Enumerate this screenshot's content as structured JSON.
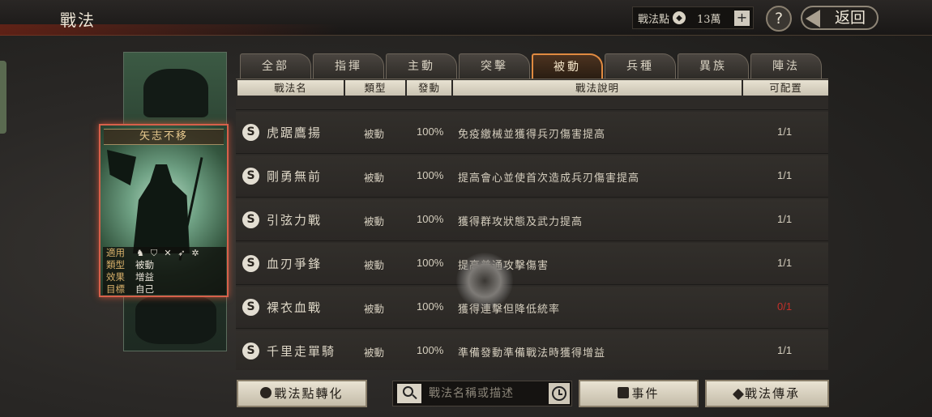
{
  "header": {
    "title": "戰法",
    "points_label": "戰法點",
    "points_value": "13萬",
    "add_label": "+",
    "help_label": "?",
    "back_label": "返回"
  },
  "card": {
    "title": "矢志不移",
    "rows": [
      {
        "key": "適用",
        "value": ""
      },
      {
        "key": "類型",
        "value": "被動"
      },
      {
        "key": "效果",
        "value": "增益"
      },
      {
        "key": "目標",
        "value": "自己"
      }
    ],
    "applicable_icons": [
      "cavalry-icon",
      "shield-icon",
      "bow-icon",
      "spear-icon",
      "siege-icon"
    ]
  },
  "tabs": [
    {
      "label": "全部",
      "active": false
    },
    {
      "label": "指揮",
      "active": false
    },
    {
      "label": "主動",
      "active": false
    },
    {
      "label": "突擊",
      "active": false
    },
    {
      "label": "被動",
      "active": true
    },
    {
      "label": "兵種",
      "active": false
    },
    {
      "label": "異族",
      "active": false
    },
    {
      "label": "陣法",
      "active": false
    }
  ],
  "table": {
    "headers": {
      "name": "戰法名",
      "type": "類型",
      "rate": "發動",
      "desc": "戰法說明",
      "conf": "可配置"
    },
    "rows": [
      {
        "grade": "S",
        "name": "虎踞鷹揚",
        "type": "被動",
        "rate": "100%",
        "desc": "免疫繳械並獲得兵刃傷害提高",
        "conf": "1/1",
        "conf_red": false
      },
      {
        "grade": "S",
        "name": "剛勇無前",
        "type": "被動",
        "rate": "100%",
        "desc": "提高會心並使首次造成兵刃傷害提高",
        "conf": "1/1",
        "conf_red": false
      },
      {
        "grade": "S",
        "name": "引弦力戰",
        "type": "被動",
        "rate": "100%",
        "desc": "獲得群攻狀態及武力提高",
        "conf": "1/1",
        "conf_red": false
      },
      {
        "grade": "S",
        "name": "血刃爭鋒",
        "type": "被動",
        "rate": "100%",
        "desc": "提高普通攻擊傷害",
        "conf": "1/1",
        "conf_red": false
      },
      {
        "grade": "S",
        "name": "裸衣血戰",
        "type": "被動",
        "rate": "100%",
        "desc": "獲得連擊但降低統率",
        "conf": "0/1",
        "conf_red": true
      },
      {
        "grade": "S",
        "name": "千里走單騎",
        "type": "被動",
        "rate": "100%",
        "desc": "準備發動準備戰法時獲得增益",
        "conf": "1/1",
        "conf_red": false
      }
    ]
  },
  "footer": {
    "convert_label": "戰法點轉化",
    "search_placeholder": "戰法名稱或描述",
    "event_label": "事件",
    "inherit_label": "戰法傳承"
  }
}
